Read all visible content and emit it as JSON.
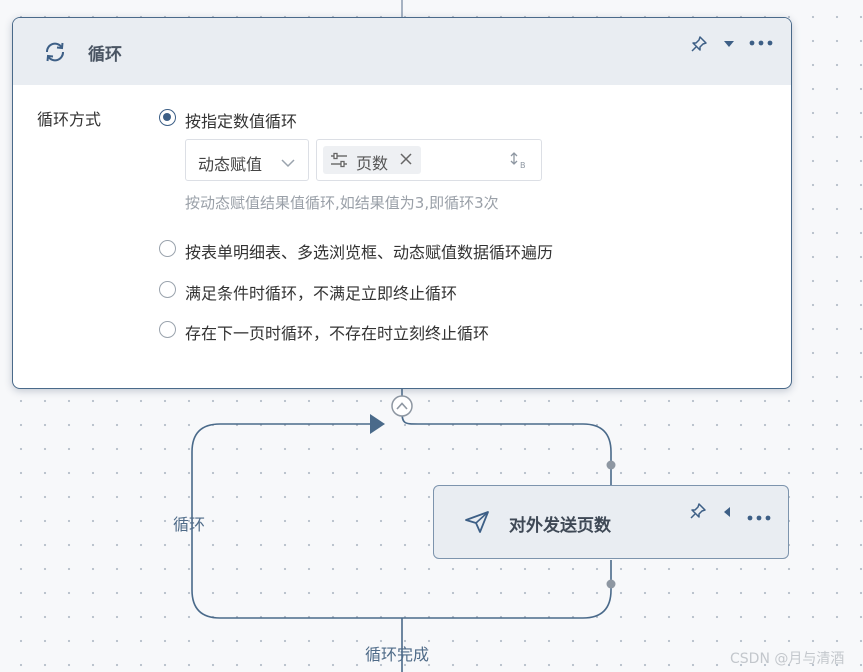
{
  "loop_card": {
    "title": "循环",
    "icons": [
      "refresh-icon",
      "pin-icon",
      "caret-down-icon",
      "more-icon"
    ],
    "method_label": "循环方式",
    "options": [
      {
        "label": "按指定数值循环",
        "checked": true
      },
      {
        "label": "按表单明细表、多选浏览框、动态赋值数据循环遍历",
        "checked": false
      },
      {
        "label": "满足条件时循环，不满足立即终止循环",
        "checked": false
      },
      {
        "label": "存在下一页时循环，不存在时立刻终止循环",
        "checked": false
      }
    ],
    "value_type_select": "动态赋值",
    "variable_tag": "页数",
    "hint": "按动态赋值结果值循环,如结果值为3,即循环3次"
  },
  "send_node": {
    "title": "对外发送页数",
    "icons": [
      "send-icon",
      "pin-icon",
      "caret-left-icon",
      "more-icon"
    ]
  },
  "flow": {
    "loop_label": "循环",
    "done_label": "循环完成"
  },
  "watermark": "CSDN @月与清酒",
  "colors": {
    "accent": "#3d5f86",
    "line": "#4a6a8a",
    "header_bg": "#e9edf2"
  }
}
